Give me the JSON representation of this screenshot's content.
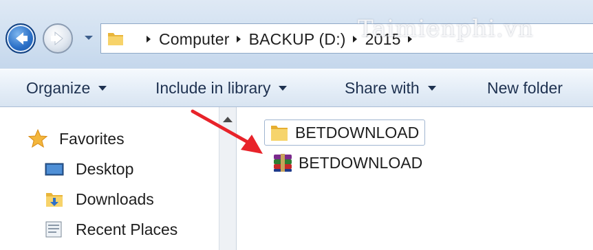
{
  "watermark": "Taimienphi.vn",
  "address_bar": {
    "crumbs": [
      "Computer",
      "BACKUP (D:)",
      "2015"
    ]
  },
  "command_bar": {
    "organize": "Organize",
    "include_in_library": "Include in library",
    "share_with": "Share with",
    "new_folder": "New folder"
  },
  "nav_pane": {
    "favorites": "Favorites",
    "items": [
      {
        "label": "Desktop",
        "icon": "desktop-icon"
      },
      {
        "label": "Downloads",
        "icon": "downloads-folder-icon"
      },
      {
        "label": "Recent Places",
        "icon": "recent-places-icon"
      }
    ]
  },
  "files": [
    {
      "name": "BETDOWNLOAD",
      "type": "folder",
      "icon": "folder-icon",
      "selected": true
    },
    {
      "name": "BETDOWNLOAD",
      "type": "rar archive",
      "icon": "winrar-archive-icon",
      "selected": false
    }
  ],
  "colors": {
    "annotation_arrow": "#e8232a",
    "back_button": "#2a6fc6",
    "folder_yellow": "#f2c24b"
  }
}
